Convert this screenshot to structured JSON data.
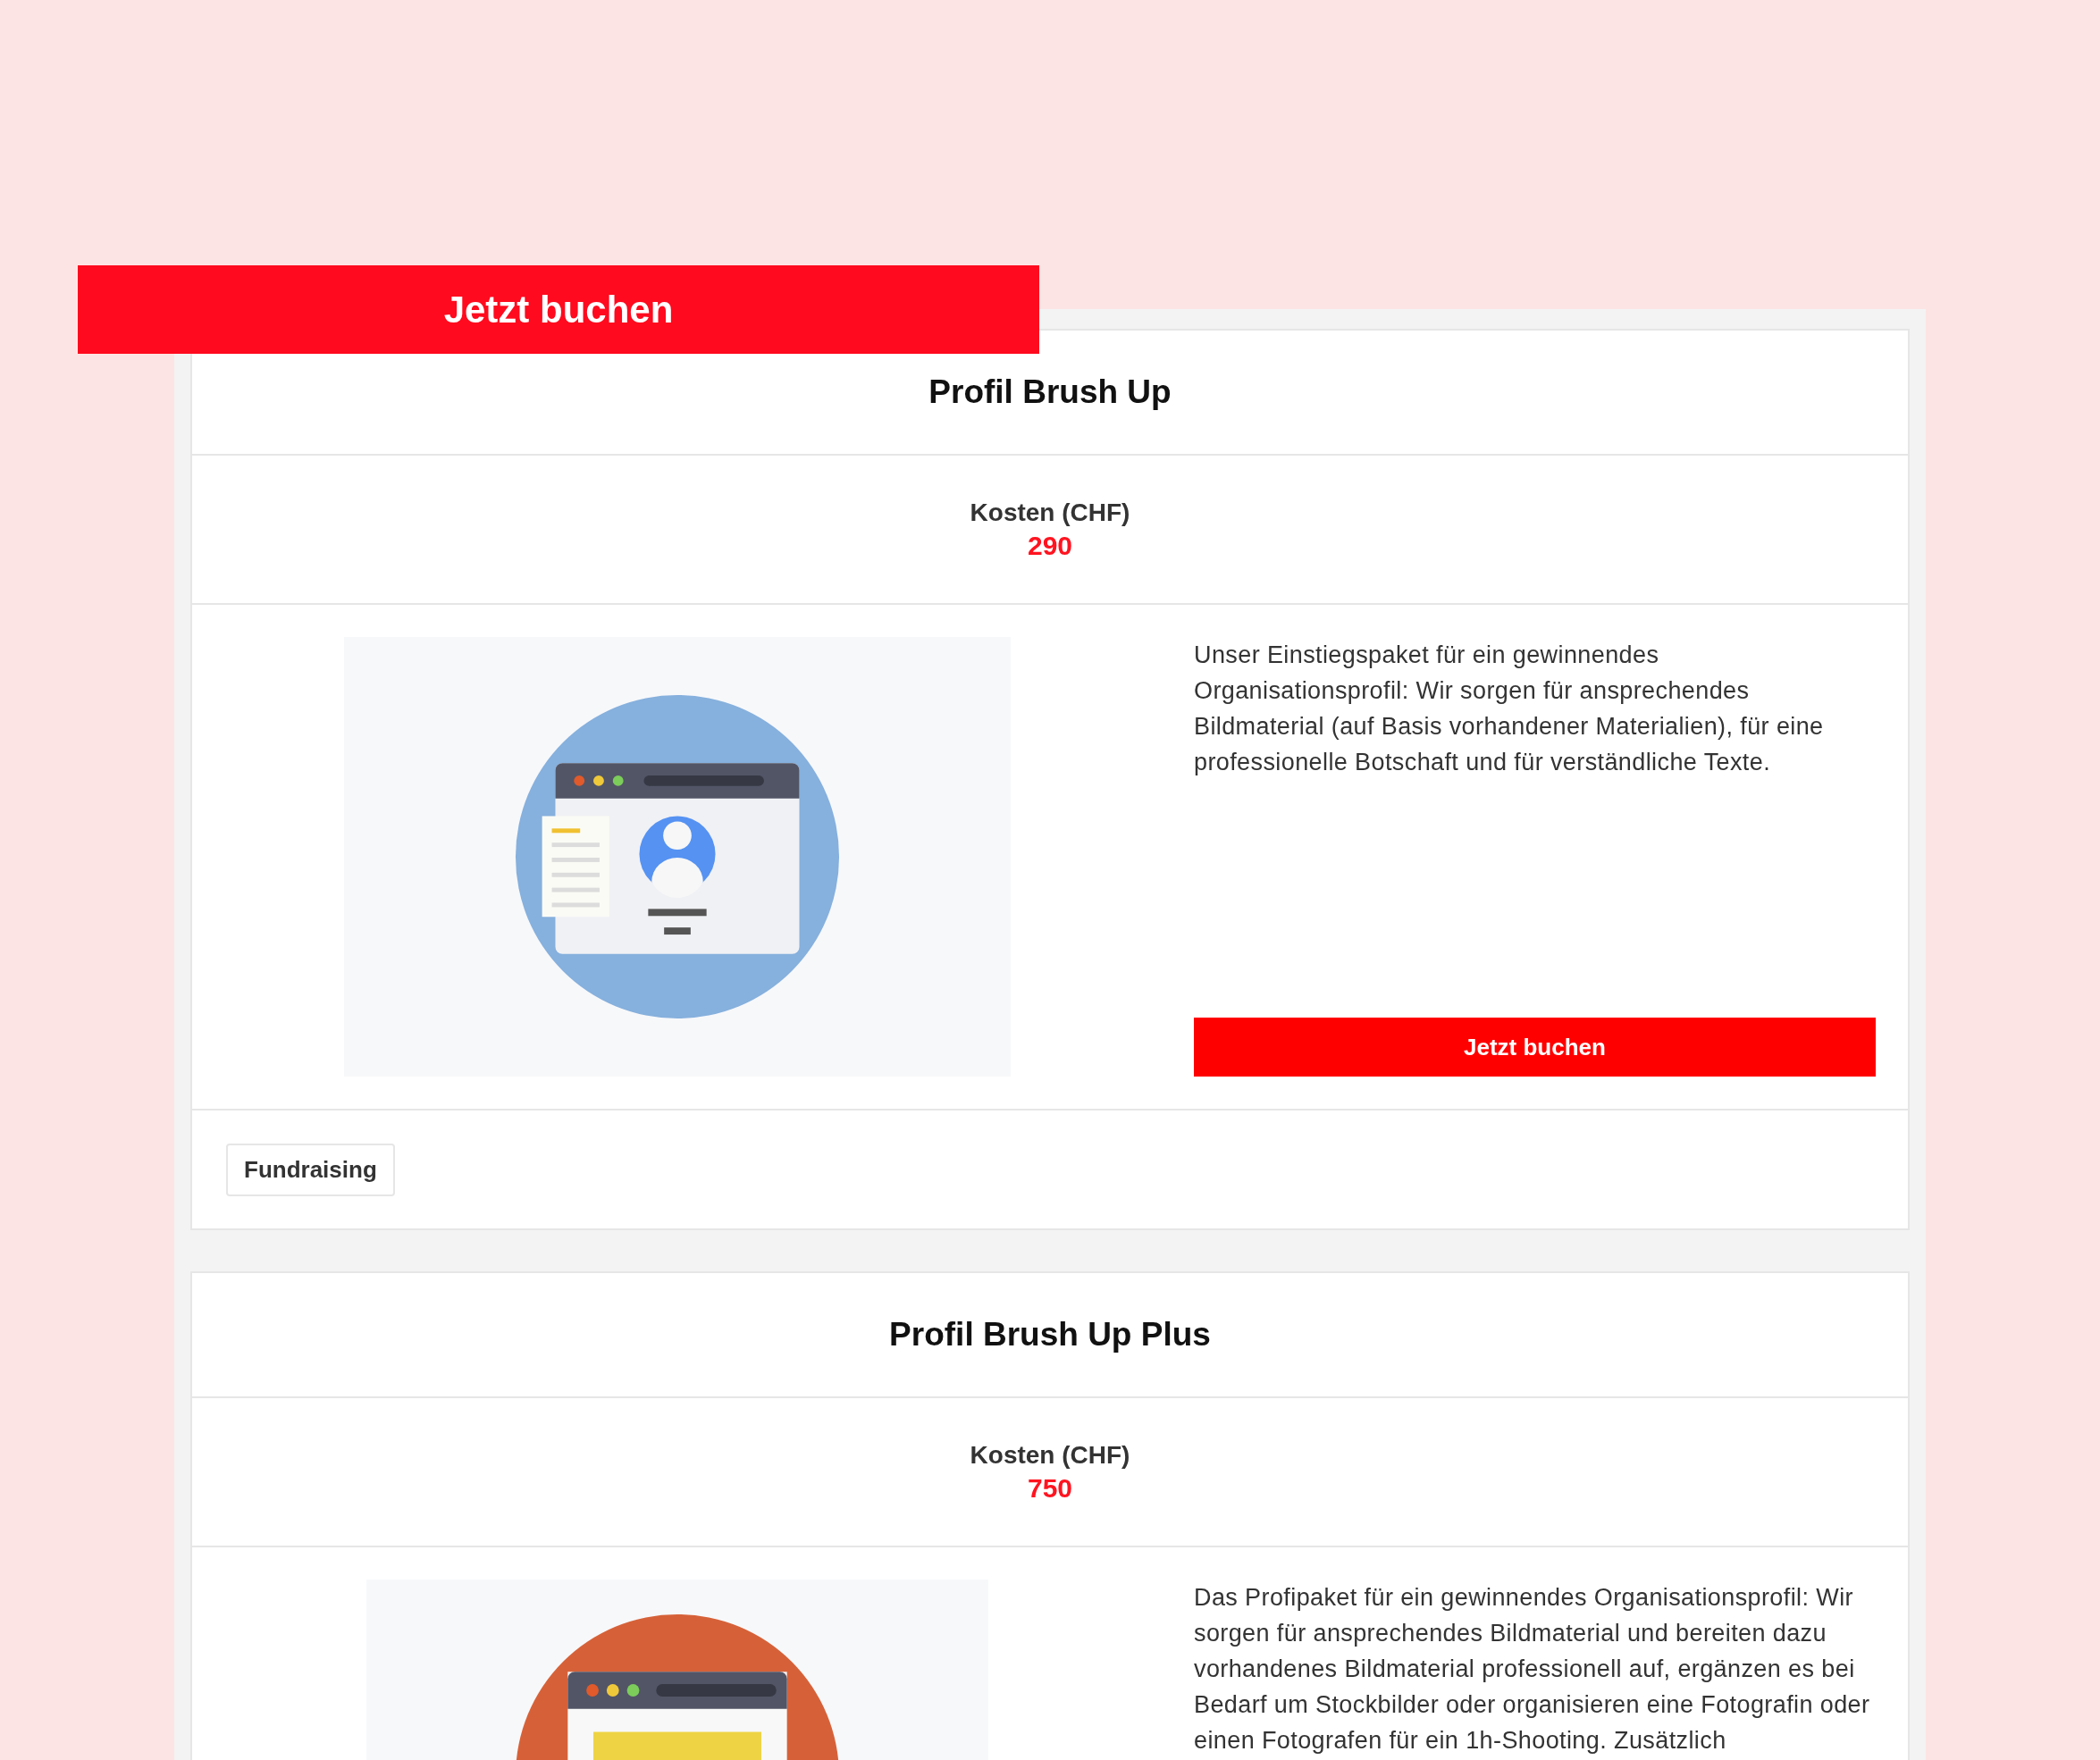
{
  "overlay_button": {
    "label": "Jetzt buchen"
  },
  "packages": [
    {
      "title": "Profil Brush Up",
      "cost_label": "Kosten (CHF)",
      "price": "290",
      "kind": "profile",
      "description": "Unser Einstiegspaket für ein gewinnendes Organisationsprofil: Wir sorgen für ansprechendes Bildmaterial (auf Basis vorhandener Materialien), für eine professionelle Botschaft und für verständliche Texte.",
      "button": "Jetzt buchen",
      "tags": [
        "Fundraising"
      ]
    },
    {
      "title": "Profil Brush Up Plus",
      "cost_label": "Kosten (CHF)",
      "price": "750",
      "kind": "website",
      "description": "Das Profipaket für ein gewinnendes Organisationsprofil: Wir sorgen für ansprechendes Bildmaterial und bereiten dazu vorhandenes Bildmaterial professionell auf, ergänzen es bei Bedarf um Stockbilder oder organisieren eine Fotografin oder einen Fotografen für ein 1h-Shooting. Zusätzlich"
    }
  ]
}
